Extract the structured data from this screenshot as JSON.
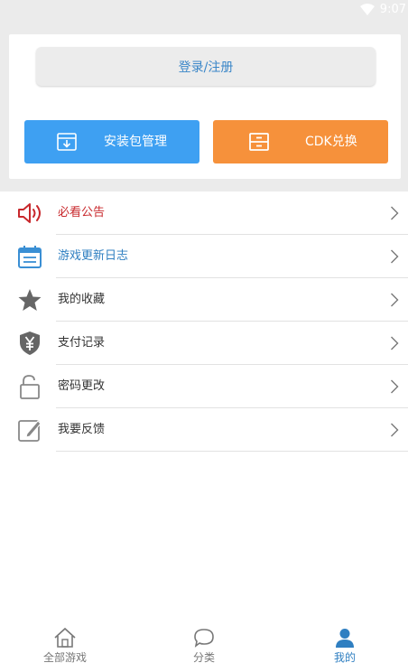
{
  "status": {
    "time": "9:07"
  },
  "account": {
    "login_label": "登录/注册"
  },
  "actions": [
    {
      "label": "安装包管理",
      "icon": "package-download-icon",
      "color": "#3ea0f2"
    },
    {
      "label": "CDK兑换",
      "icon": "cdk-icon",
      "color": "#f6913b"
    }
  ],
  "menu": [
    {
      "label": "必看公告",
      "icon": "speaker-icon",
      "color": "#c8282c"
    },
    {
      "label": "游戏更新日志",
      "icon": "calendar-log-icon",
      "color": "#2f7fc1"
    },
    {
      "label": "我的收藏",
      "icon": "star-icon"
    },
    {
      "label": "支付记录",
      "icon": "yen-shield-icon"
    },
    {
      "label": "密码更改",
      "icon": "unlock-icon"
    },
    {
      "label": "我要反馈",
      "icon": "edit-feedback-icon"
    }
  ],
  "tabs": [
    {
      "label": "全部游戏",
      "icon": "home-icon"
    },
    {
      "label": "分类",
      "icon": "chat-bubble-icon"
    },
    {
      "label": "我的",
      "icon": "user-icon",
      "active": true
    }
  ]
}
